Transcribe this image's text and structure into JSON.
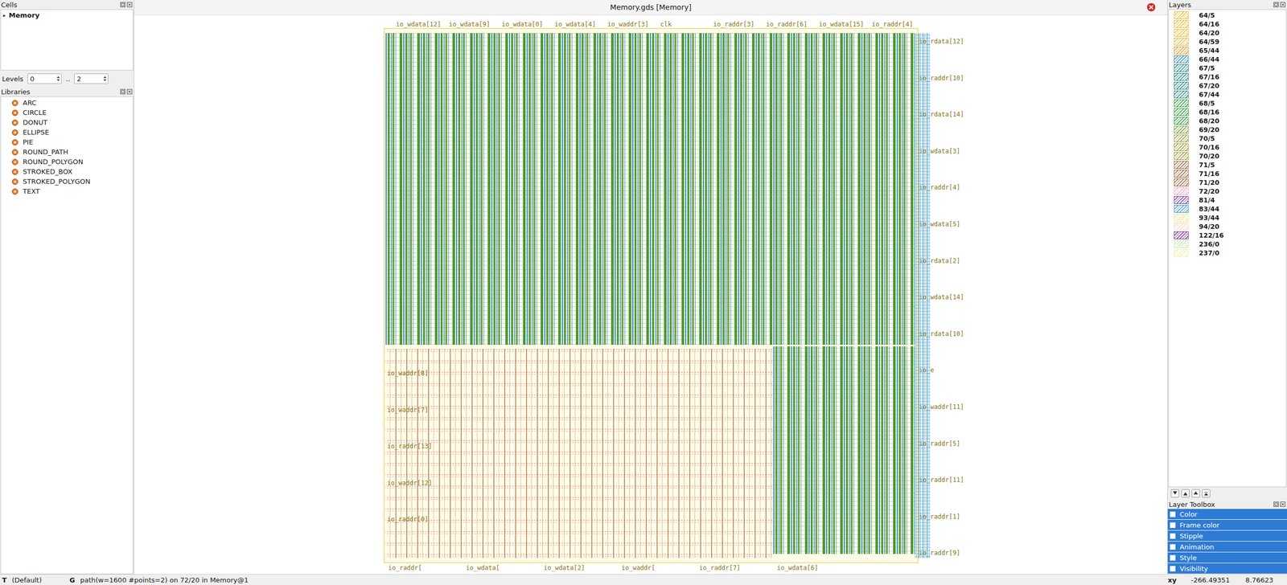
{
  "window": {
    "title": "Memory.gds [Memory]"
  },
  "cells_panel": {
    "title": "Cells",
    "items": [
      {
        "label": "Memory",
        "expander": "▸",
        "expanded": false
      }
    ]
  },
  "levels": {
    "label": "Levels",
    "from": "0",
    "separator": "..",
    "to": "2"
  },
  "libraries": {
    "title": "Libraries",
    "items": [
      "ARC",
      "CIRCLE",
      "DONUT",
      "ELLIPSE",
      "PIE",
      "ROUND_PATH",
      "ROUND_POLYGON",
      "STROKED_BOX",
      "STROKED_POLYGON",
      "TEXT"
    ]
  },
  "canvas": {
    "labels_top": [
      "io_wdata[12]",
      "io_wdata[9]",
      "io_wdata[0]",
      "io_wdata[4]",
      "io_waddr[3]",
      "clk",
      "io_raddr[3]",
      "io_raddr[6]",
      "io_wdata[15]",
      "io_raddr[4]"
    ],
    "labels_right": [
      "io_rdata[12]",
      "io_raddr[10]",
      "io_rdata[14]",
      "io_wdata[3]",
      "io_raddr[4]",
      "io_wdata[5]",
      "io_rdata[2]",
      "io_wdata[14]",
      "io_rdata[10]",
      "io_e",
      "io_waddr[11]",
      "io_raddr[5]",
      "io_raddr[11]",
      "io_raddr[1]",
      "io_raddr[9]"
    ],
    "labels_left": [
      "io_waddr[8]",
      "io_waddr[7]",
      "io_raddr[13]",
      "io_waddr[12]",
      "io_raddr[0]"
    ],
    "labels_bottom": [
      "io_raddr[",
      "io_wdata[",
      "io_wdata[2]",
      "io_waddr[",
      "io_raddr[7]",
      "io_wdata[6]"
    ]
  },
  "layers_panel": {
    "title": "Layers",
    "layers": [
      {
        "name": "64/5",
        "color": "#e8c040"
      },
      {
        "name": "64/16",
        "color": "#e8c040"
      },
      {
        "name": "64/20",
        "color": "#e8c040"
      },
      {
        "name": "64/59",
        "color": "#e8c040"
      },
      {
        "name": "65/44",
        "color": "#e0a040"
      },
      {
        "name": "66/44",
        "color": "#3a8fa8"
      },
      {
        "name": "67/5",
        "color": "#2a8a80"
      },
      {
        "name": "67/16",
        "color": "#2a8a80"
      },
      {
        "name": "67/20",
        "color": "#2a8a80"
      },
      {
        "name": "67/44",
        "color": "#2a8a80"
      },
      {
        "name": "68/5",
        "color": "#3a9a40"
      },
      {
        "name": "68/16",
        "color": "#3a9a40"
      },
      {
        "name": "68/20",
        "color": "#3a9a40"
      },
      {
        "name": "69/20",
        "color": "#7aa040"
      },
      {
        "name": "70/5",
        "color": "#a0a040"
      },
      {
        "name": "70/16",
        "color": "#a0a040"
      },
      {
        "name": "70/20",
        "color": "#a0a040"
      },
      {
        "name": "71/5",
        "color": "#a06a40"
      },
      {
        "name": "71/16",
        "color": "#a06a40"
      },
      {
        "name": "71/20",
        "color": "#a06a40"
      },
      {
        "name": "72/20",
        "color": "#f0b0c0"
      },
      {
        "name": "81/4",
        "color": "#8040a0"
      },
      {
        "name": "83/44",
        "color": "#40a0d0"
      },
      {
        "name": "93/44",
        "color": "#f0e8a0"
      },
      {
        "name": "94/20",
        "color": "#f8d8c0"
      },
      {
        "name": "122/16",
        "color": "#803090"
      },
      {
        "name": "236/0",
        "color": "#c8ecb8"
      },
      {
        "name": "237/0",
        "color": "#f0f0b0"
      }
    ]
  },
  "toolbox": {
    "title": "Layer Toolbox",
    "items": [
      {
        "label": "Color",
        "expanded": false
      },
      {
        "label": "Frame color",
        "expanded": false
      },
      {
        "label": "Stipple",
        "expanded": false
      },
      {
        "label": "Animation",
        "expanded": false
      },
      {
        "label": "Style",
        "expanded": false
      },
      {
        "label": "Visibility",
        "expanded": false
      }
    ]
  },
  "status_bar": {
    "mode": "T",
    "mode_label": "(Default)",
    "grid": "G",
    "selection": "path(w=1600 #points=2) on 72/20 in Memory@1",
    "coord_label": "xy",
    "x": "-266.49351",
    "y": "8.76623"
  }
}
